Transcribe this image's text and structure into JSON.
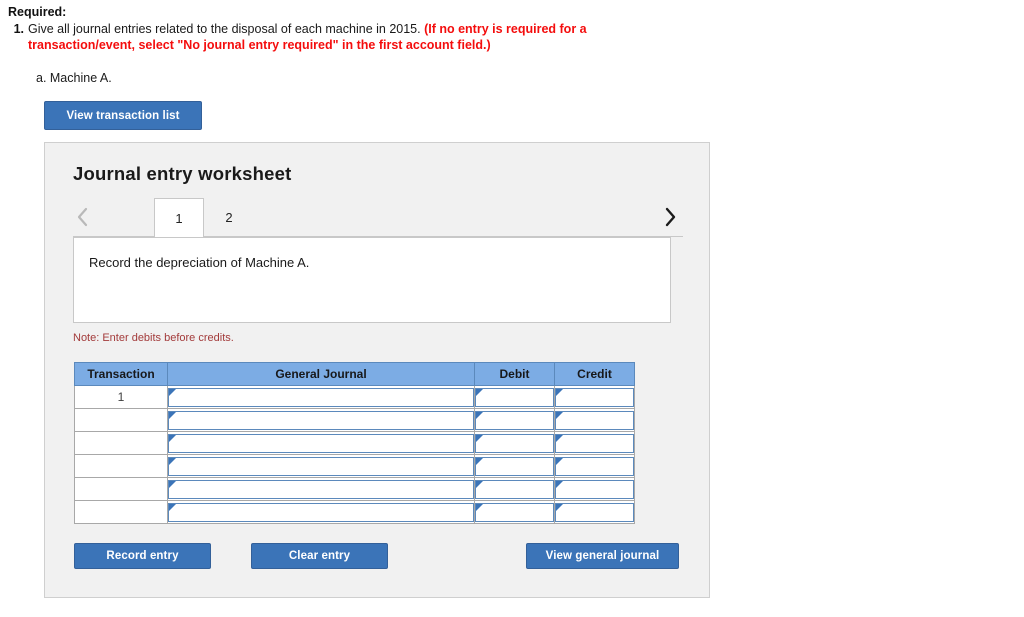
{
  "required": {
    "label": "Required:",
    "item_number": "1.",
    "item_text_plain": "Give all journal entries related to the disposal of each machine in 2015. ",
    "item_text_red": "(If no entry is required for a transaction/event, select \"No journal entry required\" in the first account field.)",
    "sub_item": "a. Machine A."
  },
  "toolbar": {
    "view_transaction_list": "View transaction list"
  },
  "worksheet": {
    "title": "Journal entry worksheet",
    "prev_icon": "chevron-left-icon",
    "next_icon": "chevron-right-icon",
    "tabs": [
      {
        "label": "1",
        "active": true
      },
      {
        "label": "2",
        "active": false
      }
    ],
    "description": "Record the depreciation of Machine A.",
    "note": "Note: Enter debits before credits."
  },
  "journal_table": {
    "headers": [
      "Transaction",
      "General Journal",
      "Debit",
      "Credit"
    ],
    "rows": [
      {
        "transaction": "1",
        "general_journal": "",
        "debit": "",
        "credit": ""
      },
      {
        "transaction": "",
        "general_journal": "",
        "debit": "",
        "credit": ""
      },
      {
        "transaction": "",
        "general_journal": "",
        "debit": "",
        "credit": ""
      },
      {
        "transaction": "",
        "general_journal": "",
        "debit": "",
        "credit": ""
      },
      {
        "transaction": "",
        "general_journal": "",
        "debit": "",
        "credit": ""
      },
      {
        "transaction": "",
        "general_journal": "",
        "debit": "",
        "credit": ""
      }
    ]
  },
  "actions": {
    "record_entry": "Record entry",
    "clear_entry": "Clear entry",
    "view_general_journal": "View general journal"
  },
  "colors": {
    "button_blue": "#3b74b8",
    "header_blue": "#7cace4",
    "panel_gray": "#f1f1f1",
    "alert_red": "#f40d0d",
    "note_red": "#a33b3b"
  }
}
